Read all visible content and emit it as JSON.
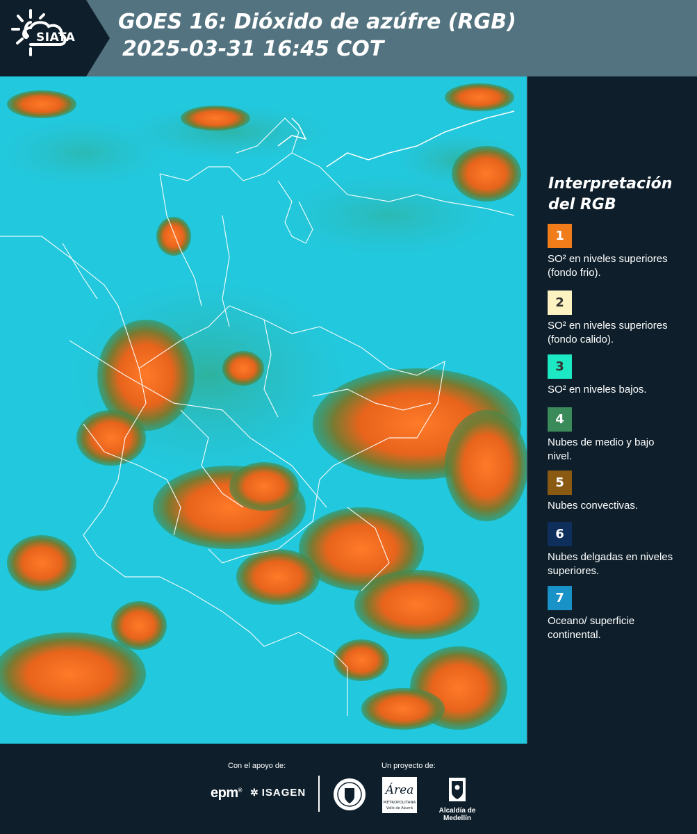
{
  "header": {
    "logo_text": "SIATA",
    "title_line1": "GOES 16: Dióxido de azúfre (RGB)",
    "title_line2": "2025-03-31 16:45 COT"
  },
  "legend": {
    "title_line1": "Interpretación",
    "title_line2": "del RGB",
    "items": [
      {
        "number": "1",
        "color": "#f07c1a",
        "text_color": "#ffffff",
        "description": "SO² en niveles superiores (fondo frio)."
      },
      {
        "number": "2",
        "color": "#fdf3c2",
        "text_color": "#333333",
        "description": "SO² en niveles superiores (fondo calido)."
      },
      {
        "number": "3",
        "color": "#1de8c4",
        "text_color": "#333333",
        "description": "SO² en niveles bajos."
      },
      {
        "number": "4",
        "color": "#3b8a5a",
        "text_color": "#ffffff",
        "description": "Nubes de medio y bajo nivel."
      },
      {
        "number": "5",
        "color": "#8a5a12",
        "text_color": "#ffffff",
        "description": "Nubes convectivas."
      },
      {
        "number": "6",
        "color": "#0e2f5c",
        "text_color": "#ffffff",
        "description": "Nubes delgadas en niveles superiores."
      },
      {
        "number": "7",
        "color": "#1992c7",
        "text_color": "#ffffff",
        "description": "Oceano/ superficie continental."
      }
    ]
  },
  "map": {
    "colors": {
      "background": "#22c8dd",
      "cloud_orange": "#f26a1e",
      "cloud_green": "#3d8a4c",
      "border": "#ffffff"
    }
  },
  "footer": {
    "support_label": "Con el apoyo de:",
    "project_label": "Un proyecto de:",
    "epm_text": "epm",
    "isagen_text": "ISAGEN",
    "area_text": "Área",
    "area_subtitle": "METROPOLITANA",
    "area_subtitle2": "Valle de Aburrá",
    "alcaldia_text": "Alcaldía de Medellín"
  }
}
